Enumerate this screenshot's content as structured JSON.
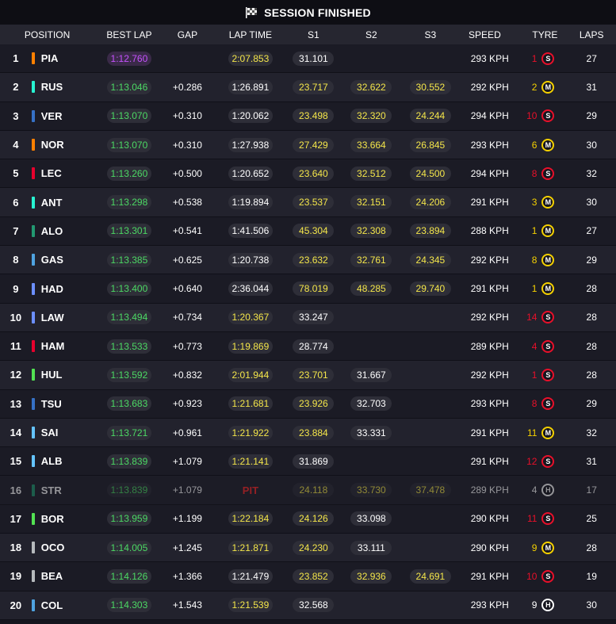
{
  "header": {
    "title": "SESSION FINISHED"
  },
  "columns": {
    "position": "POSITION",
    "best_lap": "BEST LAP",
    "gap": "GAP",
    "lap_time": "LAP TIME",
    "s1": "S1",
    "s2": "S2",
    "s3": "S3",
    "speed": "SPEED",
    "tyre": "TYRE",
    "laps": "LAPS"
  },
  "colors": {
    "personal_best": "#4cd964",
    "overall_best": "#c651ff",
    "sector_yellow": "#f4e64a",
    "soft": "#e8102a",
    "medium": "#f5d100",
    "hard": "#ffffff",
    "pit": "#ff2a2a"
  },
  "rows": [
    {
      "pos": "1",
      "driver": "PIA",
      "team_color": "#ff8000",
      "best_lap": "1:12.760",
      "best_type": "purple",
      "gap": "",
      "lap_time": "2:07.853",
      "lap_type": "yellow",
      "s1": "31.101",
      "s1_type": "white",
      "s2": "",
      "s2_type": "none",
      "s3": "",
      "s3_type": "none",
      "speed": "293 KPH",
      "tyre_age": "1",
      "tyre": "S",
      "laps": "27"
    },
    {
      "pos": "2",
      "driver": "RUS",
      "team_color": "#27f4d2",
      "best_lap": "1:13.046",
      "best_type": "green",
      "gap": "+0.286",
      "lap_time": "1:26.891",
      "lap_type": "white",
      "s1": "23.717",
      "s1_type": "yellow",
      "s2": "32.622",
      "s2_type": "yellow",
      "s3": "30.552",
      "s3_type": "yellow",
      "speed": "292 KPH",
      "tyre_age": "2",
      "tyre": "M",
      "laps": "31"
    },
    {
      "pos": "3",
      "driver": "VER",
      "team_color": "#3671c6",
      "best_lap": "1:13.070",
      "best_type": "green",
      "gap": "+0.310",
      "lap_time": "1:20.062",
      "lap_type": "white",
      "s1": "23.498",
      "s1_type": "yellow",
      "s2": "32.320",
      "s2_type": "yellow",
      "s3": "24.244",
      "s3_type": "yellow",
      "speed": "294 KPH",
      "tyre_age": "10",
      "tyre": "S",
      "laps": "29"
    },
    {
      "pos": "4",
      "driver": "NOR",
      "team_color": "#ff8000",
      "best_lap": "1:13.070",
      "best_type": "green",
      "gap": "+0.310",
      "lap_time": "1:27.938",
      "lap_type": "white",
      "s1": "27.429",
      "s1_type": "yellow",
      "s2": "33.664",
      "s2_type": "yellow",
      "s3": "26.845",
      "s3_type": "yellow",
      "speed": "293 KPH",
      "tyre_age": "6",
      "tyre": "M",
      "laps": "30"
    },
    {
      "pos": "5",
      "driver": "LEC",
      "team_color": "#e8002d",
      "best_lap": "1:13.260",
      "best_type": "green",
      "gap": "+0.500",
      "lap_time": "1:20.652",
      "lap_type": "white",
      "s1": "23.640",
      "s1_type": "yellow",
      "s2": "32.512",
      "s2_type": "yellow",
      "s3": "24.500",
      "s3_type": "yellow",
      "speed": "294 KPH",
      "tyre_age": "8",
      "tyre": "S",
      "laps": "32"
    },
    {
      "pos": "6",
      "driver": "ANT",
      "team_color": "#27f4d2",
      "best_lap": "1:13.298",
      "best_type": "green",
      "gap": "+0.538",
      "lap_time": "1:19.894",
      "lap_type": "white",
      "s1": "23.537",
      "s1_type": "yellow",
      "s2": "32.151",
      "s2_type": "yellow",
      "s3": "24.206",
      "s3_type": "yellow",
      "speed": "291 KPH",
      "tyre_age": "3",
      "tyre": "M",
      "laps": "30"
    },
    {
      "pos": "7",
      "driver": "ALO",
      "team_color": "#229971",
      "best_lap": "1:13.301",
      "best_type": "green",
      "gap": "+0.541",
      "lap_time": "1:41.506",
      "lap_type": "white",
      "s1": "45.304",
      "s1_type": "yellow",
      "s2": "32.308",
      "s2_type": "yellow",
      "s3": "23.894",
      "s3_type": "yellow",
      "speed": "288 KPH",
      "tyre_age": "1",
      "tyre": "M",
      "laps": "27"
    },
    {
      "pos": "8",
      "driver": "GAS",
      "team_color": "#4fa3e0",
      "best_lap": "1:13.385",
      "best_type": "green",
      "gap": "+0.625",
      "lap_time": "1:20.738",
      "lap_type": "white",
      "s1": "23.632",
      "s1_type": "yellow",
      "s2": "32.761",
      "s2_type": "yellow",
      "s3": "24.345",
      "s3_type": "yellow",
      "speed": "292 KPH",
      "tyre_age": "8",
      "tyre": "M",
      "laps": "29"
    },
    {
      "pos": "9",
      "driver": "HAD",
      "team_color": "#6c8fff",
      "best_lap": "1:13.400",
      "best_type": "green",
      "gap": "+0.640",
      "lap_time": "2:36.044",
      "lap_type": "white",
      "s1": "78.019",
      "s1_type": "yellow",
      "s2": "48.285",
      "s2_type": "yellow",
      "s3": "29.740",
      "s3_type": "yellow",
      "speed": "291 KPH",
      "tyre_age": "1",
      "tyre": "M",
      "laps": "28"
    },
    {
      "pos": "10",
      "driver": "LAW",
      "team_color": "#6c8fff",
      "best_lap": "1:13.494",
      "best_type": "green",
      "gap": "+0.734",
      "lap_time": "1:20.367",
      "lap_type": "yellow",
      "s1": "33.247",
      "s1_type": "white",
      "s2": "",
      "s2_type": "none",
      "s3": "",
      "s3_type": "none",
      "speed": "292 KPH",
      "tyre_age": "14",
      "tyre": "S",
      "laps": "28"
    },
    {
      "pos": "11",
      "driver": "HAM",
      "team_color": "#e8002d",
      "best_lap": "1:13.533",
      "best_type": "green",
      "gap": "+0.773",
      "lap_time": "1:19.869",
      "lap_type": "yellow",
      "s1": "28.774",
      "s1_type": "white",
      "s2": "",
      "s2_type": "none",
      "s3": "",
      "s3_type": "none",
      "speed": "289 KPH",
      "tyre_age": "4",
      "tyre": "S",
      "laps": "28"
    },
    {
      "pos": "12",
      "driver": "HUL",
      "team_color": "#52e252",
      "best_lap": "1:13.592",
      "best_type": "green",
      "gap": "+0.832",
      "lap_time": "2:01.944",
      "lap_type": "yellow",
      "s1": "23.701",
      "s1_type": "yellow",
      "s2": "31.667",
      "s2_type": "white",
      "s3": "",
      "s3_type": "none",
      "speed": "292 KPH",
      "tyre_age": "1",
      "tyre": "S",
      "laps": "28"
    },
    {
      "pos": "13",
      "driver": "TSU",
      "team_color": "#3671c6",
      "best_lap": "1:13.683",
      "best_type": "green",
      "gap": "+0.923",
      "lap_time": "1:21.681",
      "lap_type": "yellow",
      "s1": "23.926",
      "s1_type": "yellow",
      "s2": "32.703",
      "s2_type": "white",
      "s3": "",
      "s3_type": "none",
      "speed": "293 KPH",
      "tyre_age": "8",
      "tyre": "S",
      "laps": "29"
    },
    {
      "pos": "14",
      "driver": "SAI",
      "team_color": "#64c4ff",
      "best_lap": "1:13.721",
      "best_type": "green",
      "gap": "+0.961",
      "lap_time": "1:21.922",
      "lap_type": "yellow",
      "s1": "23.884",
      "s1_type": "yellow",
      "s2": "33.331",
      "s2_type": "white",
      "s3": "",
      "s3_type": "none",
      "speed": "291 KPH",
      "tyre_age": "11",
      "tyre": "M",
      "laps": "32"
    },
    {
      "pos": "15",
      "driver": "ALB",
      "team_color": "#64c4ff",
      "best_lap": "1:13.839",
      "best_type": "green",
      "gap": "+1.079",
      "lap_time": "1:21.141",
      "lap_type": "yellow",
      "s1": "31.869",
      "s1_type": "white",
      "s2": "",
      "s2_type": "none",
      "s3": "",
      "s3_type": "none",
      "speed": "291 KPH",
      "tyre_age": "12",
      "tyre": "S",
      "laps": "31"
    },
    {
      "pos": "16",
      "driver": "STR",
      "team_color": "#229971",
      "best_lap": "1:13.839",
      "best_type": "green",
      "gap": "+1.079",
      "lap_time": "PIT",
      "lap_type": "pit",
      "s1": "24.118",
      "s1_type": "yellow",
      "s2": "33.730",
      "s2_type": "yellow",
      "s3": "37.478",
      "s3_type": "yellow",
      "speed": "289 KPH",
      "tyre_age": "4",
      "tyre": "H",
      "laps": "17",
      "pit": true
    },
    {
      "pos": "17",
      "driver": "BOR",
      "team_color": "#52e252",
      "best_lap": "1:13.959",
      "best_type": "green",
      "gap": "+1.199",
      "lap_time": "1:22.184",
      "lap_type": "yellow",
      "s1": "24.126",
      "s1_type": "yellow",
      "s2": "33.098",
      "s2_type": "white",
      "s3": "",
      "s3_type": "none",
      "speed": "290 KPH",
      "tyre_age": "11",
      "tyre": "S",
      "laps": "25"
    },
    {
      "pos": "18",
      "driver": "OCO",
      "team_color": "#b6babd",
      "best_lap": "1:14.005",
      "best_type": "green",
      "gap": "+1.245",
      "lap_time": "1:21.871",
      "lap_type": "yellow",
      "s1": "24.230",
      "s1_type": "yellow",
      "s2": "33.111",
      "s2_type": "white",
      "s3": "",
      "s3_type": "none",
      "speed": "290 KPH",
      "tyre_age": "9",
      "tyre": "M",
      "laps": "28"
    },
    {
      "pos": "19",
      "driver": "BEA",
      "team_color": "#b6babd",
      "best_lap": "1:14.126",
      "best_type": "green",
      "gap": "+1.366",
      "lap_time": "1:21.479",
      "lap_type": "white",
      "s1": "23.852",
      "s1_type": "yellow",
      "s2": "32.936",
      "s2_type": "yellow",
      "s3": "24.691",
      "s3_type": "yellow",
      "speed": "291 KPH",
      "tyre_age": "10",
      "tyre": "S",
      "laps": "19"
    },
    {
      "pos": "20",
      "driver": "COL",
      "team_color": "#4fa3e0",
      "best_lap": "1:14.303",
      "best_type": "green",
      "gap": "+1.543",
      "lap_time": "1:21.539",
      "lap_type": "yellow",
      "s1": "32.568",
      "s1_type": "white",
      "s2": "",
      "s2_type": "none",
      "s3": "",
      "s3_type": "none",
      "speed": "293 KPH",
      "tyre_age": "9",
      "tyre": "H",
      "laps": "30"
    }
  ]
}
